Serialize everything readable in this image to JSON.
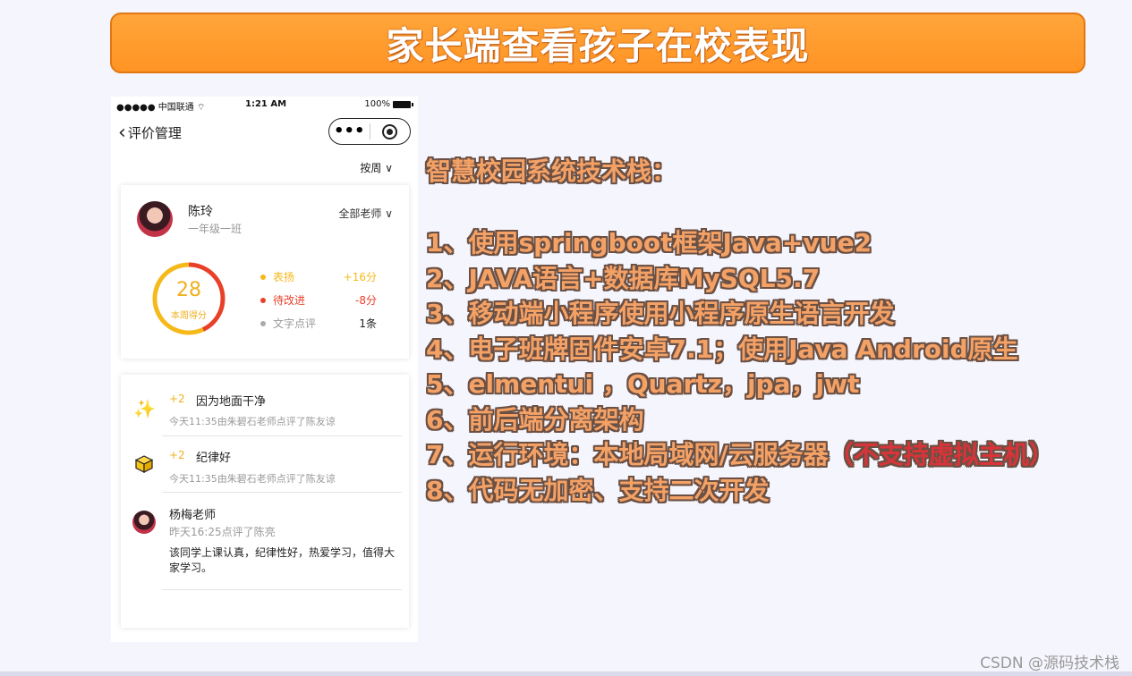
{
  "banner": {
    "title": "家长端查看孩子在校表现"
  },
  "phone": {
    "status": {
      "carrier": "●●●●● 中国联通 ⌔",
      "time": "1:21 AM",
      "battery": "100%"
    },
    "nav": {
      "back_icon": "‹",
      "title": "评价管理",
      "more_icon": "•••"
    },
    "period": {
      "label": "按周",
      "arrow": "∨"
    },
    "student": {
      "name": "陈玲",
      "class": "一年级一班",
      "teacher_filter": "全部老师",
      "filter_arrow": "∨",
      "score": "28",
      "score_label": "本周得分",
      "praise_fraction": 0.57,
      "colors": {
        "praise": "#f5b91a",
        "improve": "#e9402a",
        "comment": "#aaaaaa"
      },
      "legend": [
        {
          "label": "表扬",
          "value": "+16分"
        },
        {
          "label": "待改进",
          "value": "-8分"
        },
        {
          "label": "文字点评",
          "value": "1条"
        }
      ]
    },
    "records": [
      {
        "icon": "sparkles-icon",
        "glyph": "✨",
        "points": "+2",
        "reason": "因为地面干净",
        "meta": "今天11:35由朱碧石老师点评了陈友谅"
      },
      {
        "icon": "cube-icon",
        "points": "+2",
        "reason": "纪律好",
        "meta": "今天11:35由朱碧石老师点评了陈友谅"
      }
    ],
    "teacher_comment": {
      "teacher": "杨梅老师",
      "meta": "昨天16:25点评了陈亮",
      "comment": "该同学上课认真，纪律性好，热爱学习，值得大家学习。"
    }
  },
  "tech": {
    "heading": "智慧校园系统技术栈：",
    "items": [
      "1、使用springboot框架Java+vue2",
      "2、JAVA语言+数据库MySQL5.7",
      "3、移动端小程序使用小程序原生语言开发",
      "4、电子班牌固件安卓7.1；使用Java Android原生",
      "5、elmentui ，Quartz，jpa，jwt",
      "6、前后端分离架构"
    ],
    "item7_main": "7、运行环境：本地局域网/云服务器",
    "item7_note": "（不支持虚拟主机）",
    "item8": "8、代码无加密、支持二次开发"
  },
  "watermark": "CSDN @源码技术栈"
}
